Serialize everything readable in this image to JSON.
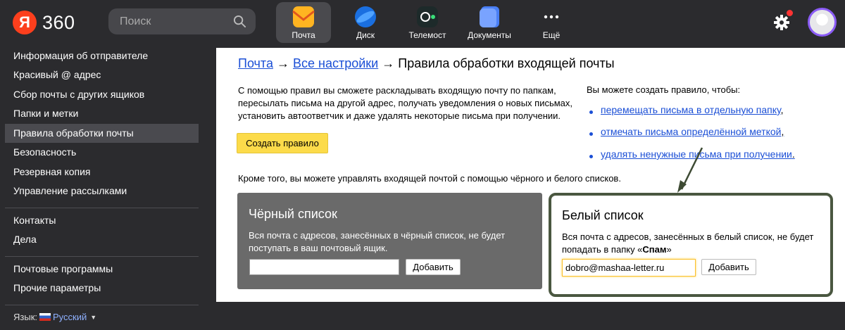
{
  "header": {
    "logo_letter": "Я",
    "logo_text": "360",
    "search_placeholder": "Поиск",
    "services": [
      {
        "label": "Почта",
        "icon": "mail-icon",
        "active": true
      },
      {
        "label": "Диск",
        "icon": "disk-icon"
      },
      {
        "label": "Телемост",
        "icon": "telemost-icon"
      },
      {
        "label": "Документы",
        "icon": "documents-icon"
      },
      {
        "label": "Ещё",
        "icon": "more-icon"
      }
    ]
  },
  "sidebar": {
    "items": [
      {
        "label": "Информация об отправителе"
      },
      {
        "label": "Красивый @ адрес"
      },
      {
        "label": "Сбор почты с других ящиков"
      },
      {
        "label": "Папки и метки"
      },
      {
        "label": "Правила обработки почты",
        "active": true
      },
      {
        "label": "Безопасность"
      },
      {
        "label": "Резервная копия"
      },
      {
        "label": "Управление рассылками"
      },
      {
        "label": "Контакты"
      },
      {
        "label": "Дела"
      },
      {
        "label": "Почтовые программы"
      },
      {
        "label": "Прочие параметры"
      }
    ],
    "lang_label": "Язык:",
    "lang_value": "Русский"
  },
  "main": {
    "crumb_mail": "Почта",
    "crumb_sep": "→",
    "crumb_settings": "Все настройки",
    "crumb_current": "Правила обработки входящей почты",
    "intro": "С помощью правил вы сможете раскладывать входящую почту по папкам, пересылать письма на другой адрес, получать уведомления о новых письмах, установить автоответчик и даже удалять некоторые письма при получении.",
    "create_button": "Создать правило",
    "can_title": "Вы можете создать правило, чтобы:",
    "rules": [
      "перемещать письма в отдельную папку",
      "отмечать письма определённой меткой",
      "удалять ненужные письма при получении"
    ],
    "rule_punct": [
      ",",
      ",",
      "."
    ],
    "also": "Кроме того, вы можете управлять входящей почтой с помощью чёрного и белого списков.",
    "black": {
      "title": "Чёрный список",
      "desc": "Вся почта с адресов, занесённых в чёрный список, не будет поступать в ваш почтовый ящик.",
      "input_value": "",
      "add_button": "Добавить"
    },
    "white": {
      "title": "Белый список",
      "desc_prefix": "Вся почта с адресов, занесённых в белый список, не будет попадать в папку «",
      "desc_bold": "Спам",
      "desc_suffix": "»",
      "input_value": "dobro@mashaa-letter.ru",
      "add_button": "Добавить"
    }
  },
  "colors": {
    "accent_yellow": "#fcdb4a",
    "link_blue": "#1b4fd6",
    "highlight_frame": "#4a5740",
    "logo_red": "#fc3f1d"
  }
}
